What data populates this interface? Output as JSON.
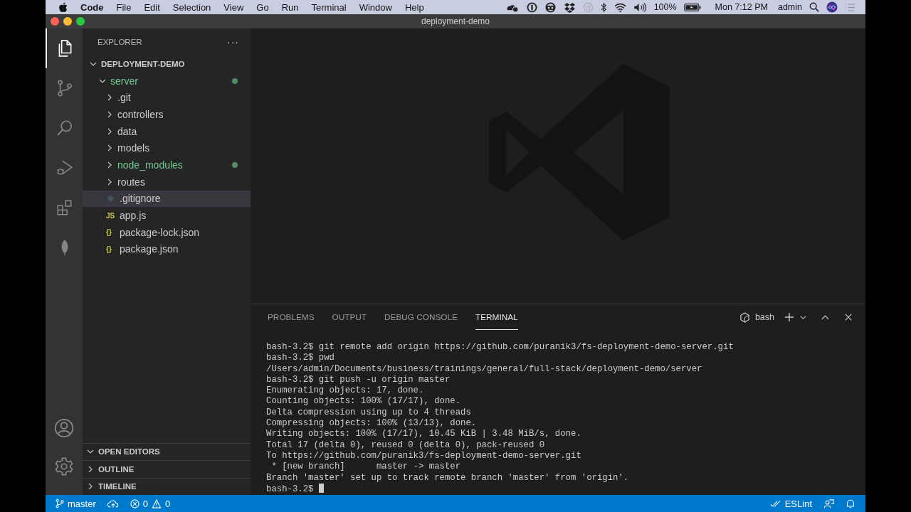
{
  "menu_bar": {
    "app_name": "Code",
    "menus": [
      "File",
      "Edit",
      "Selection",
      "View",
      "Go",
      "Run",
      "Terminal",
      "Window",
      "Help"
    ],
    "battery_percent": "100%",
    "clock": "Mon 7:12 PM",
    "user": "admin"
  },
  "window": {
    "title": "deployment-demo"
  },
  "activity_bar": {
    "items": [
      {
        "kind": "files",
        "selected": true
      },
      {
        "kind": "source-control",
        "selected": false
      },
      {
        "kind": "search",
        "selected": false
      },
      {
        "kind": "debug",
        "selected": false
      },
      {
        "kind": "extensions",
        "selected": false
      },
      {
        "kind": "leaf",
        "selected": false
      }
    ]
  },
  "explorer": {
    "title": "EXPLORER",
    "more": "···",
    "tree": [
      {
        "label": "DEPLOYMENT-DEMO",
        "kind": "root",
        "expanded": true,
        "children": [
          {
            "label": "server",
            "kind": "folder",
            "expanded": true,
            "untracked": true,
            "selected": false,
            "children": [
              {
                "label": ".git",
                "kind": "folder",
                "expanded": false,
                "untracked": false,
                "selected": false
              },
              {
                "label": "controllers",
                "kind": "folder",
                "expanded": false,
                "untracked": false,
                "selected": false
              },
              {
                "label": "data",
                "kind": "folder",
                "expanded": false,
                "untracked": false,
                "selected": false
              },
              {
                "label": "models",
                "kind": "folder",
                "expanded": false,
                "untracked": false,
                "selected": false
              },
              {
                "label": "node_modules",
                "kind": "folder",
                "expanded": false,
                "untracked": true,
                "selected": false
              },
              {
                "label": "routes",
                "kind": "folder",
                "expanded": false,
                "untracked": false,
                "selected": false
              },
              {
                "label": ".gitignore",
                "kind": "gitignore",
                "untracked": false,
                "selected": true
              },
              {
                "label": "app.js",
                "kind": "js",
                "icon_text": "JS",
                "untracked": false,
                "selected": false
              },
              {
                "label": "package-lock.json",
                "kind": "json",
                "icon_text": "{}",
                "untracked": false,
                "selected": false
              },
              {
                "label": "package.json",
                "kind": "json",
                "icon_text": "{}",
                "untracked": false,
                "selected": false
              }
            ]
          }
        ]
      }
    ],
    "sections": [
      {
        "label": "OPEN EDITORS",
        "expanded": true
      },
      {
        "label": "OUTLINE",
        "expanded": false
      },
      {
        "label": "TIMELINE",
        "expanded": false
      }
    ]
  },
  "panel": {
    "tabs": [
      {
        "label": "PROBLEMS",
        "selected": false
      },
      {
        "label": "OUTPUT",
        "selected": false
      },
      {
        "label": "DEBUG CONSOLE",
        "selected": false
      },
      {
        "label": "TERMINAL",
        "selected": true
      }
    ],
    "shell": "bash",
    "terminal_lines": [
      "bash-3.2$ git remote add origin https://github.com/puranik3/fs-deployment-demo-server.git",
      "bash-3.2$ pwd",
      "/Users/admin/Documents/business/trainings/general/full-stack/deployment-demo/server",
      "bash-3.2$ git push -u origin master",
      "Enumerating objects: 17, done.",
      "Counting objects: 100% (17/17), done.",
      "Delta compression using up to 4 threads",
      "Compressing objects: 100% (13/13), done.",
      "Writing objects: 100% (17/17), 10.45 KiB | 3.48 MiB/s, done.",
      "Total 17 (delta 0), reused 0 (delta 0), pack-reused 0",
      "To https://github.com/puranik3/fs-deployment-demo-server.git",
      " * [new branch]      master -> master",
      "Branch 'master' set up to track remote branch 'master' from 'origin'."
    ],
    "prompt": "bash-3.2$"
  },
  "status_bar": {
    "branch": "master",
    "errors": "0",
    "warnings": "0",
    "linter": "ESLint"
  }
}
